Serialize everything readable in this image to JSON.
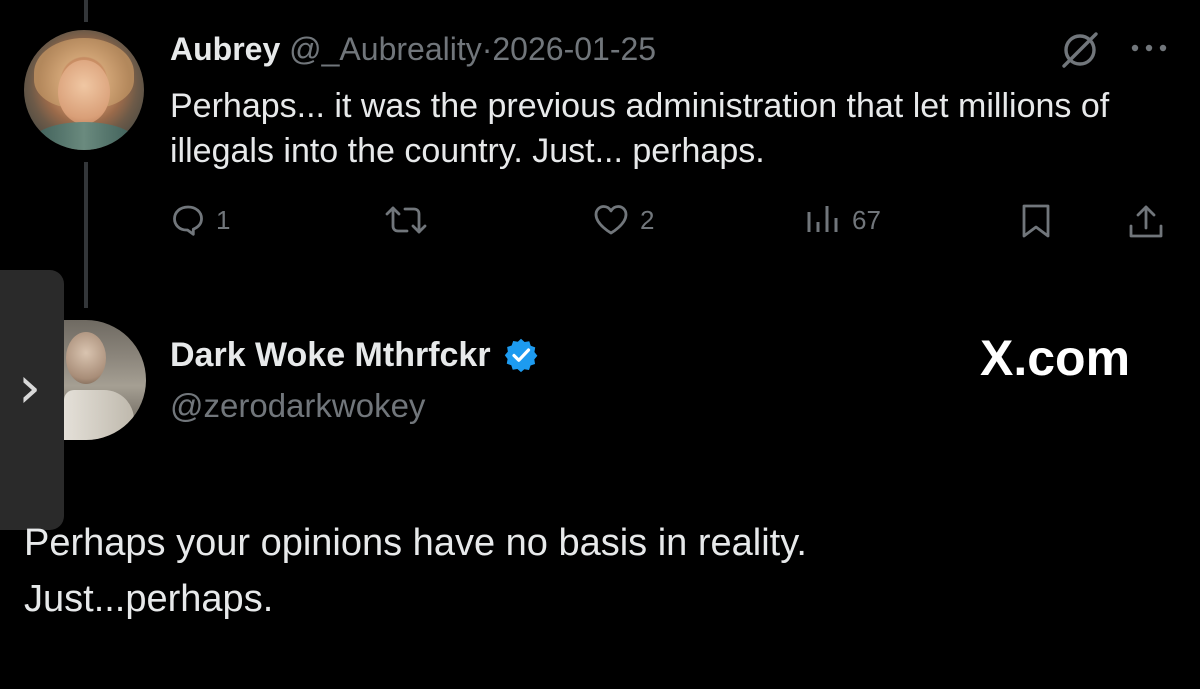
{
  "reply_tweet": {
    "author_name": "Aubrey",
    "handle": "@_Aubreality",
    "separator": "·",
    "date": "2026-01-25",
    "text": "Perhaps... it was the previous administration that let millions of illegals into the country. Just... perhaps.",
    "stats": {
      "replies": "1",
      "likes": "2",
      "views": "67"
    }
  },
  "quoted_tweet": {
    "author_name": "Dark Woke Mthrfckr",
    "handle": "@zerodarkwokey",
    "verified": true,
    "text_line1": "Perhaps your opinions have no basis in reality.",
    "text_line2": "Just...perhaps."
  },
  "watermark": "X.com",
  "side_handle_glyph": "›",
  "colors": {
    "background": "#000000",
    "text": "#e7e9ea",
    "muted": "#71767b",
    "verified": "#1d9bf0",
    "thread_line": "#333639"
  },
  "icons": {
    "reply": "speech-bubble-icon",
    "repost": "repost-arrows-icon",
    "like": "heart-icon",
    "views": "bar-chart-icon",
    "bookmark": "bookmark-icon",
    "share": "share-upload-icon",
    "grok": "grok-slash-icon",
    "more": "ellipsis-icon",
    "verified": "verified-badge-icon"
  }
}
